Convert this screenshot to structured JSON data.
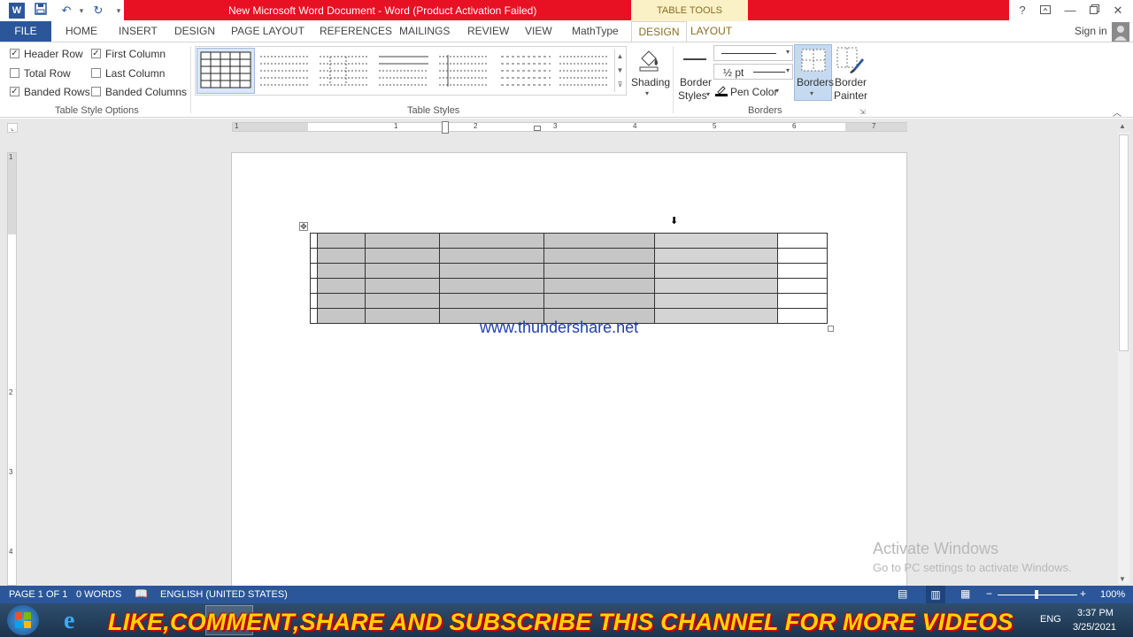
{
  "title_bar": {
    "document_title": "New Microsoft Word Document - Word (Product Activation Failed)",
    "context_tab_group": "TABLE TOOLS",
    "help": "?",
    "accent_color": "#e81123"
  },
  "tabs": {
    "file": "FILE",
    "home": "HOME",
    "insert": "INSERT",
    "design": "DESIGN",
    "page_layout": "PAGE LAYOUT",
    "references": "REFERENCES",
    "mailings": "MAILINGS",
    "review": "REVIEW",
    "view": "VIEW",
    "mathtype": "MathType",
    "table_design": "DESIGN",
    "table_layout": "LAYOUT",
    "sign_in": "Sign in"
  },
  "ribbon": {
    "table_style_options": {
      "label": "Table Style Options",
      "header_row": {
        "label": "Header Row",
        "checked": true
      },
      "total_row": {
        "label": "Total Row",
        "checked": false
      },
      "banded_rows": {
        "label": "Banded Rows",
        "checked": true
      },
      "first_column": {
        "label": "First Column",
        "checked": true
      },
      "last_column": {
        "label": "Last Column",
        "checked": false
      },
      "banded_columns": {
        "label": "Banded Columns",
        "checked": false
      }
    },
    "table_styles": {
      "label": "Table Styles"
    },
    "shading": "Shading",
    "border_styles_line1": "Border",
    "border_styles_line2": "Styles",
    "pen_weight": "½ pt",
    "pen_color": "Pen Color",
    "borders": "Borders",
    "border_painter_line1": "Border",
    "border_painter_line2": "Painter",
    "borders_group_label": "Borders"
  },
  "ruler": {
    "h_numbers": [
      "1",
      "1",
      "2",
      "3",
      "4",
      "5",
      "6",
      "7"
    ],
    "v_numbers": [
      "1",
      "2",
      "3",
      "4"
    ]
  },
  "document": {
    "watermark_text": "www.thundershare.net",
    "table_rows": 6,
    "table_cols": 6
  },
  "activation": {
    "line1": "Activate Windows",
    "line2": "Go to PC settings to activate Windows."
  },
  "status_bar": {
    "page": "PAGE 1 OF 1",
    "words": "0 WORDS",
    "language": "ENGLISH (UNITED STATES)",
    "zoom": "100%",
    "zoom_level": 1.0,
    "color": "#2b579a"
  },
  "taskbar": {
    "banner": "LIKE,COMMENT,SHARE AND SUBSCRIBE THIS CHANNEL FOR MORE VIDEOS",
    "lang": "ENG",
    "time": "3:37 PM",
    "date": "3/25/2021"
  }
}
